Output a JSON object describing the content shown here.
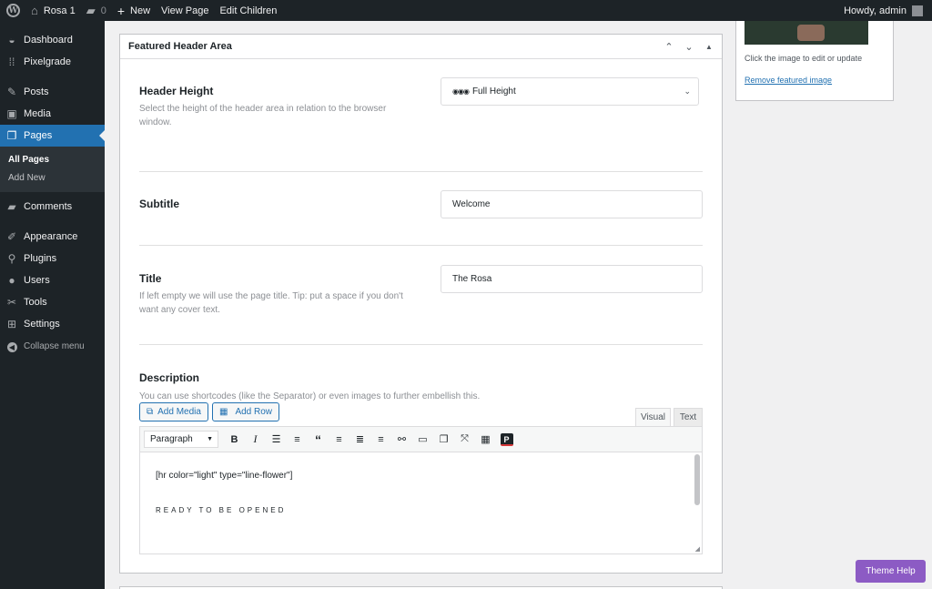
{
  "adminbar": {
    "site_name": "Rosa 1",
    "comments_count": "0",
    "new_label": "New",
    "view_page": "View Page",
    "edit_children": "Edit Children",
    "howdy": "Howdy, admin"
  },
  "sidebar": {
    "items": [
      {
        "label": "Dashboard",
        "icon": "dashboard-icon"
      },
      {
        "label": "Pixelgrade",
        "icon": "grid-icon"
      },
      {
        "label": "Posts",
        "icon": "pin-icon"
      },
      {
        "label": "Media",
        "icon": "media-icon"
      },
      {
        "label": "Pages",
        "icon": "pages-icon"
      },
      {
        "label": "Comments",
        "icon": "comment-icon"
      },
      {
        "label": "Appearance",
        "icon": "brush-icon"
      },
      {
        "label": "Plugins",
        "icon": "plug-icon"
      },
      {
        "label": "Users",
        "icon": "user-icon"
      },
      {
        "label": "Tools",
        "icon": "wrench-icon"
      },
      {
        "label": "Settings",
        "icon": "settings-icon"
      },
      {
        "label": "Collapse menu",
        "icon": "collapse-icon"
      }
    ],
    "submenu": [
      "All Pages",
      "Add New"
    ]
  },
  "postbox": {
    "title": "Featured Header Area",
    "fields": {
      "header_height": {
        "label": "Header Height",
        "desc": "Select the height of the header area in relation to the browser window.",
        "value": "Full Height"
      },
      "subtitle": {
        "label": "Subtitle",
        "value": "Welcome"
      },
      "title": {
        "label": "Title",
        "desc": "If left empty we will use the page title. Tip: put a space if you don't want any cover text.",
        "value": "The Rosa"
      },
      "description": {
        "label": "Description",
        "desc": "You can use shortcodes (like the Separator) or even images to further embellish this."
      }
    },
    "editor": {
      "add_media": "Add Media",
      "add_row": "Add Row",
      "tab_visual": "Visual",
      "tab_text": "Text",
      "format": "Paragraph",
      "content_line1": "[hr color=\"light\" type=\"line-flower\"]",
      "content_line2": "READY TO BE OPENED"
    }
  },
  "featured_image": {
    "hint": "Click the image to edit or update",
    "remove": "Remove featured image"
  },
  "theme_help": "Theme Help"
}
